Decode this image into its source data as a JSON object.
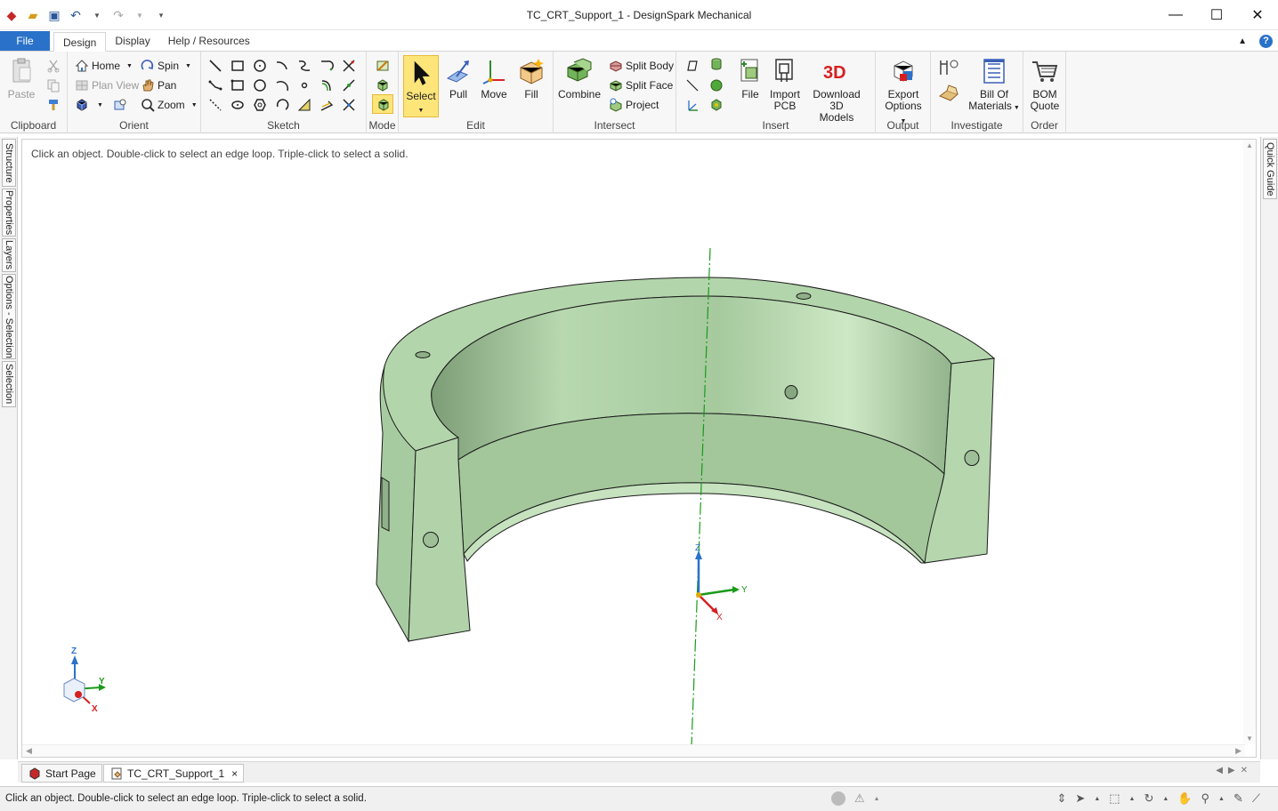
{
  "window": {
    "title": "TC_CRT_Support_1 - DesignSpark Mechanical",
    "minimize": "—",
    "maximize": "☐",
    "close": "✕"
  },
  "tabs": {
    "file": "File",
    "items": [
      "Design",
      "Display",
      "Help / Resources"
    ],
    "active": "Design"
  },
  "ribbon": {
    "clipboard": {
      "label": "Clipboard",
      "paste": "Paste"
    },
    "orient": {
      "label": "Orient",
      "home": "Home",
      "plan_view": "Plan View",
      "spin": "Spin",
      "pan": "Pan",
      "zoom": "Zoom"
    },
    "sketch": {
      "label": "Sketch"
    },
    "mode": {
      "label": "Mode"
    },
    "edit": {
      "label": "Edit",
      "select": "Select",
      "pull": "Pull",
      "move": "Move",
      "fill": "Fill"
    },
    "intersect": {
      "label": "Intersect",
      "combine": "Combine",
      "split_body": "Split Body",
      "split_face": "Split Face",
      "project": "Project"
    },
    "insert": {
      "label": "Insert",
      "file": "File",
      "import_pcb_1": "Import",
      "import_pcb_2": "PCB",
      "download_1": "Download 3D",
      "download_2": "Models"
    },
    "output": {
      "label": "Output",
      "export_1": "Export",
      "export_2": "Options"
    },
    "investigate": {
      "label": "Investigate",
      "bom_1": "Bill Of",
      "bom_2": "Materials"
    },
    "order": {
      "label": "Order",
      "quote_1": "BOM",
      "quote_2": "Quote"
    }
  },
  "side_tabs": [
    "Structure",
    "Properties",
    "Layers",
    "Options - Selection",
    "Selection"
  ],
  "right_tabs": [
    "Quick Guide"
  ],
  "viewport": {
    "hint": "Click an object. Double-click to select an edge loop. Triple-click to select a solid.",
    "axis_x": "X",
    "axis_y": "Y",
    "axis_z": "Z"
  },
  "doc_tabs": [
    {
      "label": "Start Page"
    },
    {
      "label": "TC_CRT_Support_1",
      "close": "×"
    }
  ],
  "status": {
    "text": "Click an object. Double-click to select an edge loop. Triple-click to select a solid."
  },
  "colors": {
    "file_tab": "#2a72c9",
    "model_fill": "#a9cfa2",
    "model_edge": "#1a1a1a",
    "select_highlight": "#fde57a"
  }
}
